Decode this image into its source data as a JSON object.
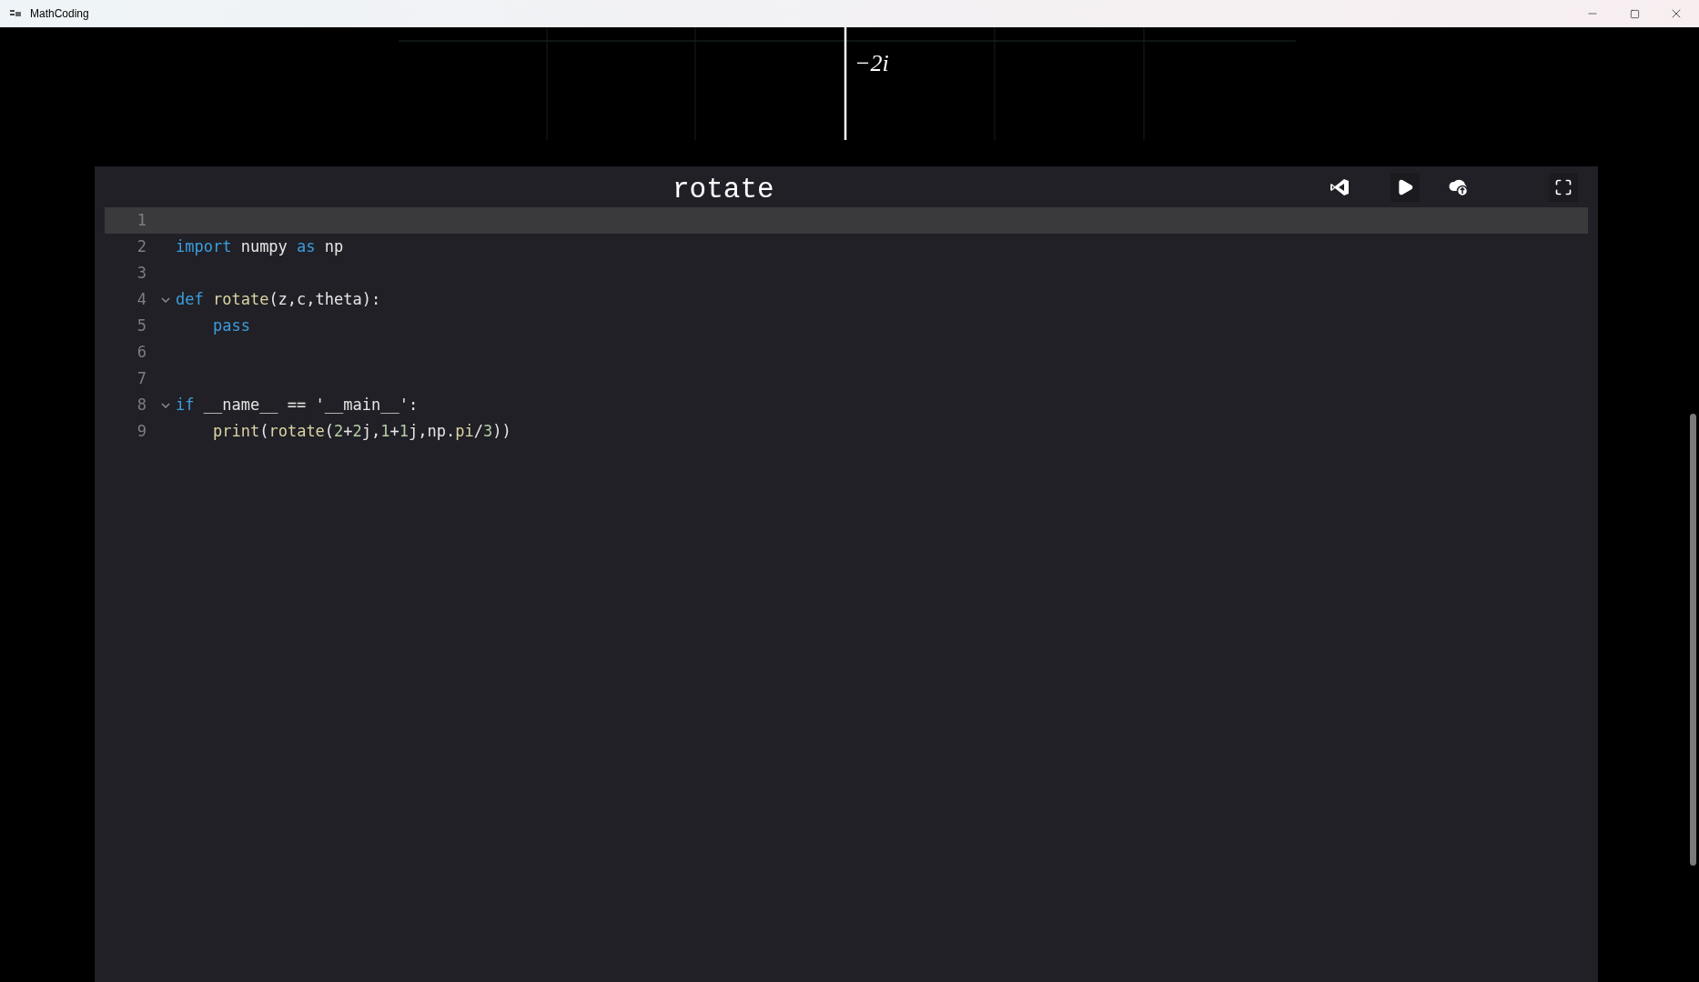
{
  "window": {
    "title": "MathCoding"
  },
  "graph": {
    "axis_label": "−2i"
  },
  "editor": {
    "title": "rotate",
    "lines": [
      {
        "number": "1",
        "selected": true,
        "foldable": false
      },
      {
        "number": "2",
        "selected": false,
        "foldable": false,
        "tokens": [
          {
            "text": "import",
            "kind": "keyword"
          },
          {
            "text": " numpy ",
            "kind": "plain"
          },
          {
            "text": "as",
            "kind": "keyword"
          },
          {
            "text": " np",
            "kind": "plain"
          }
        ]
      },
      {
        "number": "3",
        "selected": false,
        "foldable": false
      },
      {
        "number": "4",
        "selected": false,
        "foldable": true,
        "tokens": [
          {
            "text": "def",
            "kind": "keyword"
          },
          {
            "text": " rotate",
            "kind": "function"
          },
          {
            "text": "(z,c,theta):",
            "kind": "plain"
          }
        ],
        "children": [
          {
            "number": "5",
            "selected": false,
            "foldable": false,
            "tokens": [
              {
                "text": "pass",
                "kind": "keyword"
              }
            ]
          }
        ]
      },
      {
        "number": "6",
        "selected": false,
        "foldable": false
      },
      {
        "number": "7",
        "selected": false,
        "foldable": false
      },
      {
        "number": "8",
        "selected": false,
        "foldable": true,
        "tokens": [
          {
            "text": "if",
            "kind": "keyword"
          },
          {
            "text": " __name__ == '__main__':",
            "kind": "plain"
          }
        ],
        "children": [
          {
            "number": "9",
            "selected": false,
            "foldable": false,
            "tokens": [
              {
                "text": "print",
                "kind": "function"
              },
              {
                "text": "(",
                "kind": "plain"
              },
              {
                "text": "rotate",
                "kind": "function"
              },
              {
                "text": "(",
                "kind": "plain"
              },
              {
                "text": "2",
                "kind": "number"
              },
              {
                "text": "+",
                "kind": "plain"
              },
              {
                "text": "2",
                "kind": "number"
              },
              {
                "text": "j,",
                "kind": "plain"
              },
              {
                "text": "1",
                "kind": "number"
              },
              {
                "text": "+",
                "kind": "plain"
              },
              {
                "text": "1",
                "kind": "number"
              },
              {
                "text": "j,np.",
                "kind": "plain"
              },
              {
                "text": "pi",
                "kind": "function"
              },
              {
                "text": "/",
                "kind": "plain"
              },
              {
                "text": "3",
                "kind": "number"
              },
              {
                "text": "))",
                "kind": "plain"
              }
            ]
          }
        ]
      }
    ]
  }
}
